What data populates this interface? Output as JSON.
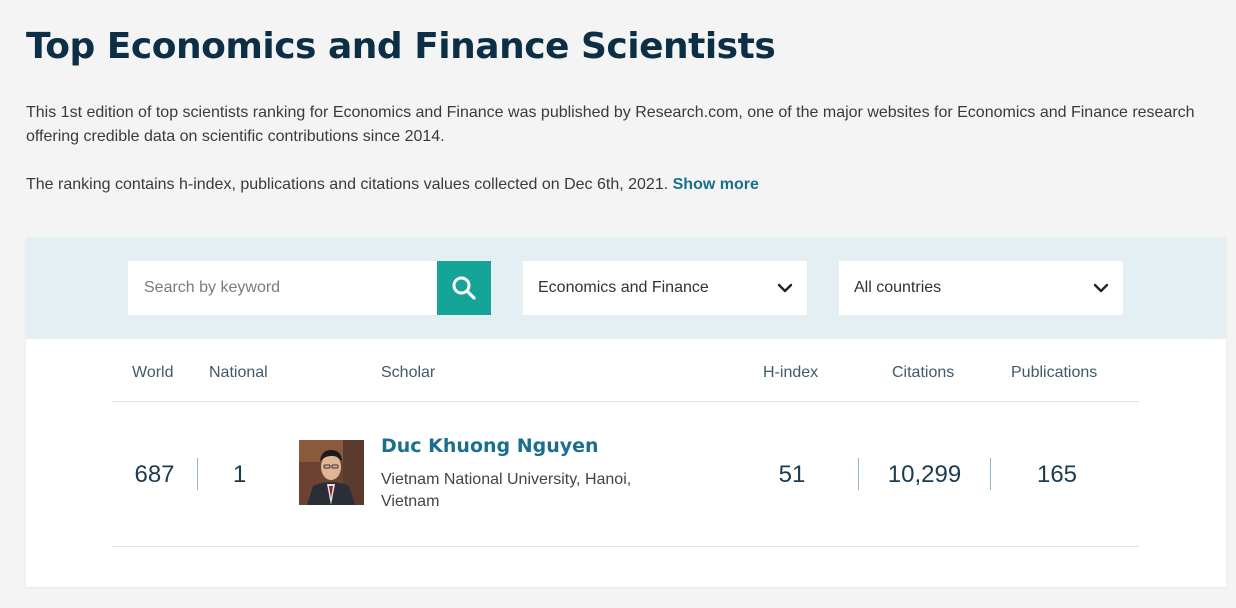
{
  "page": {
    "title": "Top Economics and Finance Scientists",
    "intro_p1": "This 1st edition of top scientists ranking for Economics and Finance was published by Research.com, one of the major websites for Economics and Finance research offering credible data on scientific contributions since 2014.",
    "intro_p2": "The ranking contains h-index, publications and citations values collected on Dec 6th, 2021.",
    "show_more": "Show more"
  },
  "filters": {
    "search_placeholder": "Search by keyword",
    "search_icon": "search-icon",
    "discipline": "Economics and Finance",
    "country": "All countries",
    "dropdown_icon": "chevron-down-icon"
  },
  "table": {
    "headers": {
      "world": "World",
      "national": "National",
      "scholar": "Scholar",
      "hindex": "H-index",
      "citations": "Citations",
      "publications": "Publications"
    },
    "rows": [
      {
        "world": "687",
        "national": "1",
        "name": "Duc Khuong Nguyen",
        "affiliation": "Vietnam National University, Hanoi, Vietnam",
        "hindex": "51",
        "citations": "10,299",
        "publications": "165"
      }
    ]
  },
  "colors": {
    "title": "#0d2f45",
    "accent": "#16a398",
    "link": "#1a6f8f",
    "filter_bar": "#e4eff3"
  }
}
